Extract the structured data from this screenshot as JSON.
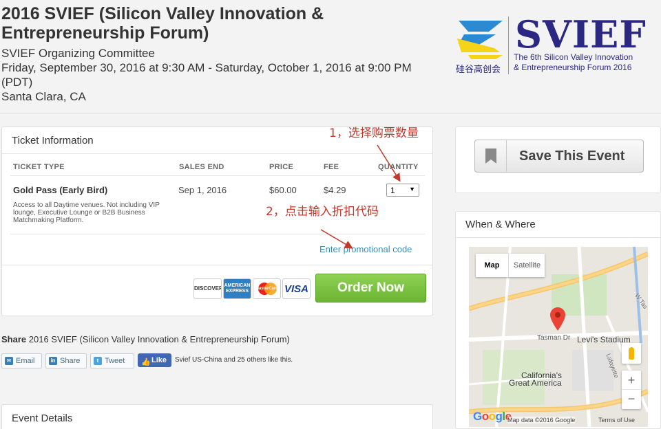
{
  "event": {
    "title": "2016 SVIEF (Silicon Valley Innovation & Entrepreneurship Forum)",
    "organizer": "SVIEF Organizing Committee",
    "date_range": "Friday, September 30, 2016 at 9:30 AM - Saturday, October 1, 2016 at 9:00 PM (PDT)",
    "location": "Santa Clara, CA"
  },
  "logo": {
    "big": "SVIEF",
    "line1": "The 6th Silicon Valley Innovation",
    "line2": "& Entrepreneurship Forum 2016",
    "cn": "硅谷高创会",
    "colors": {
      "navy": "#2a2882",
      "blue": "#2b8ad2",
      "yellow": "#f4d319"
    }
  },
  "ticket": {
    "heading": "Ticket Information",
    "columns": {
      "type": "TICKET TYPE",
      "sales_end": "SALES END",
      "price": "PRICE",
      "fee": "FEE",
      "quantity": "QUANTITY"
    },
    "rows": [
      {
        "name": "Gold Pass (Early Bird)",
        "description": "Access to all Daytime venues. Not including VIP lounge, Executive Lounge or B2B Business Matchmaking Platform.",
        "sales_end": "Sep 1, 2016",
        "price": "$60.00",
        "fee": "$4.29",
        "quantity": "1"
      }
    ],
    "promo_link": "Enter promotional code",
    "cards": {
      "discover": "DISCOVER",
      "amex": "AMERICAN EXPRESS",
      "mastercard": "MasterCard",
      "visa": "VISA"
    },
    "order_button": "Order Now"
  },
  "annotations": {
    "step1": "1，选择购票数量",
    "step2": "2，点击输入折扣代码",
    "color": "#c0392b"
  },
  "share": {
    "prefix": "Share",
    "text": "2016 SVIEF (Silicon Valley Innovation & Entrepreneurship Forum)",
    "email": "Email",
    "share": "Share",
    "tweet": "Tweet",
    "like": "Like",
    "like_text": "Svief US-China and 25 others like this."
  },
  "details": {
    "heading": "Event Details"
  },
  "sidebar": {
    "save_label": "Save This Event",
    "where_heading": "When & Where"
  },
  "map": {
    "type_map": "Map",
    "type_satellite": "Satellite",
    "labels": {
      "tasman": "Tasman Dr",
      "levis": "Levi's Stadium",
      "ca_line1": "California's",
      "ca_line2": "Great America",
      "w_tas": "W Tas",
      "lafayette": "Lafayette"
    },
    "zoom_in": "+",
    "zoom_out": "−",
    "google": "Google",
    "attribution": "Map data ©2016 Google",
    "terms": "Terms of Use"
  }
}
